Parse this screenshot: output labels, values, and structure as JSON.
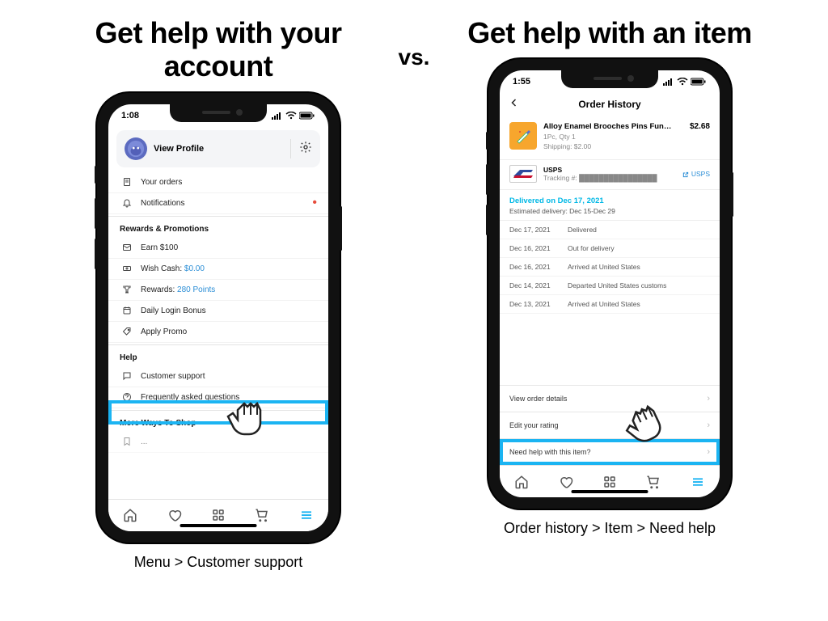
{
  "left": {
    "title": "Get help with your account",
    "caption": "Menu > Customer support",
    "status": {
      "time": "1:08"
    },
    "profile": {
      "label": "View Profile"
    },
    "sections": {
      "top": [
        {
          "icon": "orders",
          "label": "Your orders"
        },
        {
          "icon": "bell",
          "label": "Notifications",
          "dot": true
        }
      ],
      "rewards_header": "Rewards & Promotions",
      "rewards": [
        {
          "icon": "mail",
          "label": "Earn $100"
        },
        {
          "icon": "cash",
          "label": "Wish Cash:",
          "value": "$0.00"
        },
        {
          "icon": "trophy",
          "label": "Rewards:",
          "value": "280 Points"
        },
        {
          "icon": "calendar",
          "label": "Daily Login Bonus"
        },
        {
          "icon": "tag",
          "label": "Apply Promo"
        }
      ],
      "help_header": "Help",
      "help": [
        {
          "icon": "chat",
          "label": "Customer support"
        },
        {
          "icon": "question",
          "label": "Frequently asked questions"
        }
      ],
      "more_header": "More Ways To Shop"
    }
  },
  "vs": "vs.",
  "right": {
    "title": "Get help with an item",
    "caption": "Order history > Item > Need help",
    "status": {
      "time": "1:55"
    },
    "nav_title": "Order History",
    "item": {
      "title": "Alloy Enamel Brooches Pins Fun…",
      "qty": "1Pc, Qty 1",
      "shipping": "Shipping: $2.00",
      "price": "$2.68"
    },
    "carrier": {
      "name": "USPS",
      "tracking_label": "Tracking #:",
      "tracking_masked": "████████████████",
      "link": "USPS"
    },
    "delivery": {
      "delivered_on": "Delivered on Dec 17, 2021",
      "estimated": "Estimated delivery: Dec 15-Dec 29"
    },
    "tracking": [
      {
        "date": "Dec 17, 2021",
        "status": "Delivered"
      },
      {
        "date": "Dec 16, 2021",
        "status": "Out for delivery"
      },
      {
        "date": "Dec 16, 2021",
        "status": "Arrived at United States"
      },
      {
        "date": "Dec 14, 2021",
        "status": "Departed United States customs"
      },
      {
        "date": "Dec 13, 2021",
        "status": "Arrived at United States"
      }
    ],
    "actions": [
      "View order details",
      "Edit your rating",
      "Need help with this item?"
    ]
  }
}
